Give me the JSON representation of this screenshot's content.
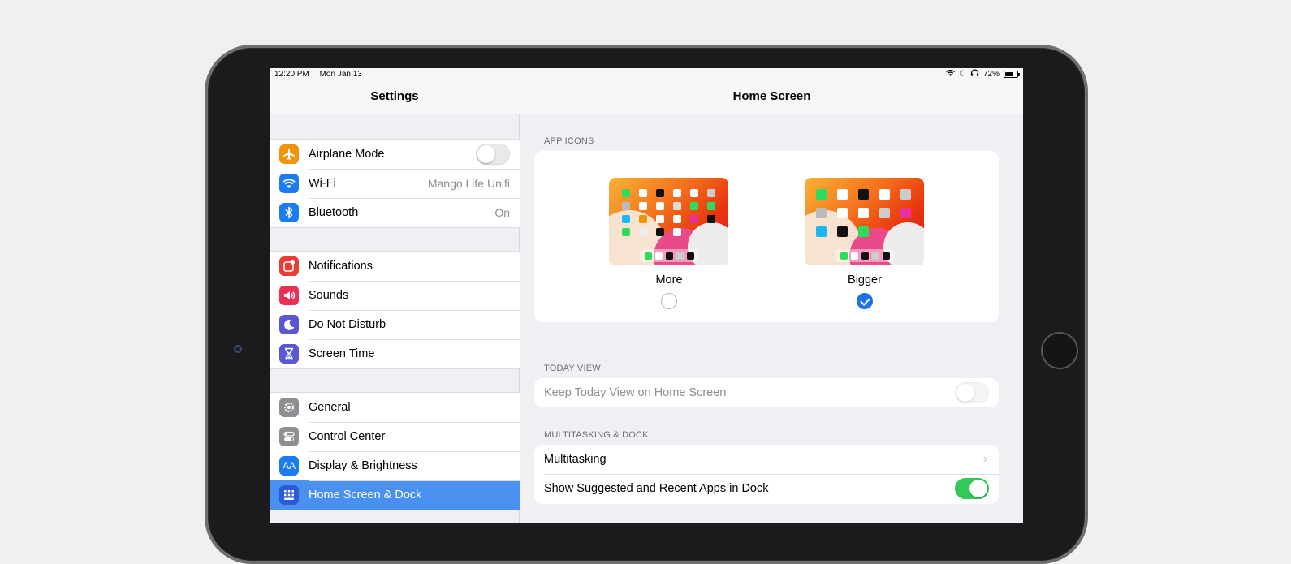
{
  "statusbar": {
    "time": "12:20 PM",
    "date": "Mon Jan 13",
    "battery": "72%"
  },
  "sidebar": {
    "title": "Settings",
    "groups": [
      [
        {
          "label": "Airplane Mode",
          "icon": "airplane-icon",
          "color": "#f0950a",
          "toggle": false
        },
        {
          "label": "Wi-Fi",
          "icon": "wifi-icon",
          "color": "#1a7cf0",
          "value": "Mango Life Unifi"
        },
        {
          "label": "Bluetooth",
          "icon": "bluetooth-icon",
          "color": "#1a7cf0",
          "value": "On"
        }
      ],
      [
        {
          "label": "Notifications",
          "icon": "notifications-icon",
          "color": "#eb3b35"
        },
        {
          "label": "Sounds",
          "icon": "speaker-icon",
          "color": "#eb2f55"
        },
        {
          "label": "Do Not Disturb",
          "icon": "moon-icon",
          "color": "#5b56d6"
        },
        {
          "label": "Screen Time",
          "icon": "hourglass-icon",
          "color": "#5b56d6"
        }
      ],
      [
        {
          "label": "General",
          "icon": "gear-icon",
          "color": "#8e8e93"
        },
        {
          "label": "Control Center",
          "icon": "switches-icon",
          "color": "#8e8e93"
        },
        {
          "label": "Display & Brightness",
          "icon": "text-size-icon",
          "color": "#1a7cf0"
        },
        {
          "label": "Home Screen & Dock",
          "icon": "home-grid-icon",
          "color": "#2b5bd8",
          "selected": true
        }
      ]
    ]
  },
  "detail": {
    "title": "Home Screen",
    "app_icons": {
      "section_label": "APP ICONS",
      "options": [
        {
          "label": "More",
          "selected": false
        },
        {
          "label": "Bigger",
          "selected": true
        }
      ]
    },
    "today_view": {
      "section_label": "TODAY VIEW",
      "row_label": "Keep Today View on Home Screen",
      "toggle": false,
      "enabled": false
    },
    "multitasking": {
      "section_label": "MULTITASKING & DOCK",
      "rows": [
        {
          "label": "Multitasking",
          "chevron": true
        },
        {
          "label": "Show Suggested and Recent Apps in Dock",
          "toggle": true
        }
      ]
    }
  }
}
